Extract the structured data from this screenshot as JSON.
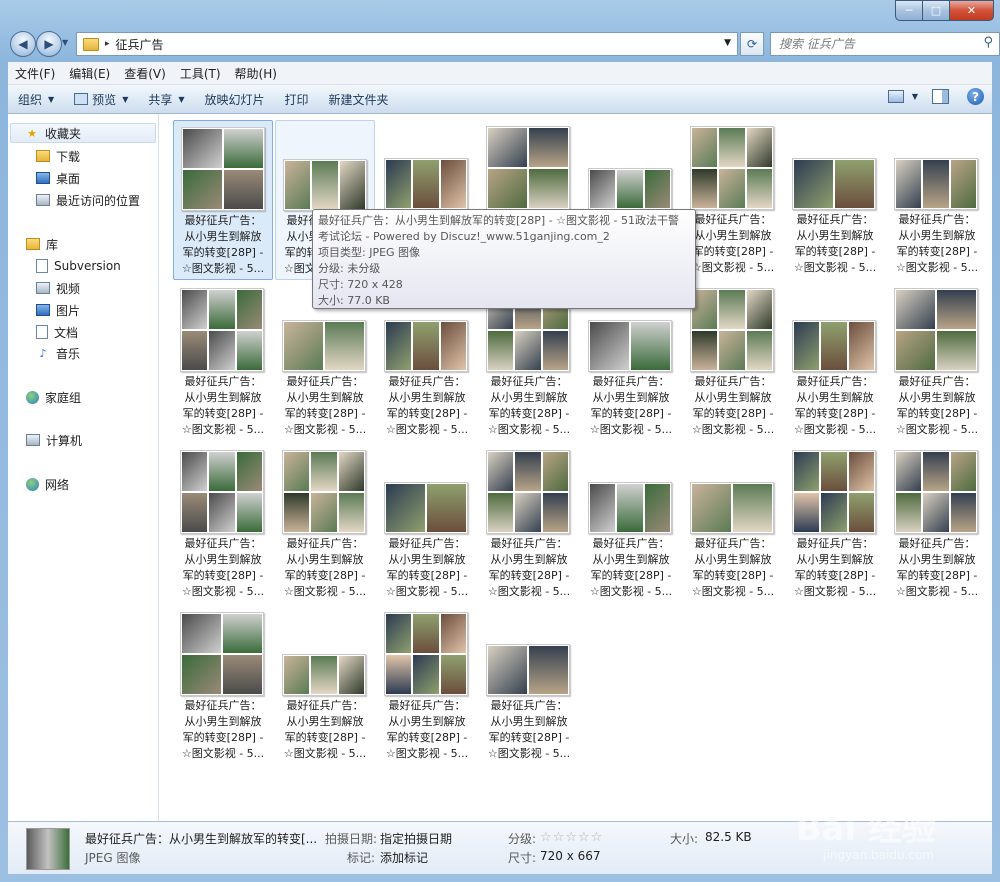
{
  "window": {
    "min_glyph": "─",
    "max_glyph": "□",
    "close_glyph": "✕"
  },
  "address": {
    "folder": "征兵广告",
    "separator": "▸"
  },
  "search": {
    "placeholder": "搜索 征兵广告"
  },
  "menu": [
    "文件(F)",
    "编辑(E)",
    "查看(V)",
    "工具(T)",
    "帮助(H)"
  ],
  "toolbar": {
    "organize": "组织",
    "preview": "预览",
    "share": "共享",
    "slideshow": "放映幻灯片",
    "print": "打印",
    "new_folder": "新建文件夹",
    "help": "?"
  },
  "sidebar": {
    "favorites": "收藏夹",
    "downloads": "下载",
    "desktop": "桌面",
    "recent": "最近访问的位置",
    "libraries": "库",
    "subversion": "Subversion",
    "videos": "视频",
    "pictures": "图片",
    "documents": "文档",
    "music": "音乐",
    "homegroup": "家庭组",
    "computer": "计算机",
    "network": "网络"
  },
  "file_caption": "最好征兵广告：\n从小男生到解放\n军的转变[28P] -\n☆图文影视 - 5...",
  "file_count": 28,
  "tooltip": {
    "name_line1": "最好征兵广告：从小男生到解放军的转变[28P] - ☆图文影视 - 51政法干警",
    "name_line2": "考试论坛 - Powered by Discuz!_www.51ganjing.com_2",
    "type": "项目类型: JPEG 图像",
    "rating": "分级: 未分级",
    "dimensions": "尺寸: 720 x 428",
    "size": "大小: 77.0 KB"
  },
  "details": {
    "name": "最好征兵广告：从小男生到解放军的转变[...",
    "type": "JPEG 图像",
    "date_label": "拍摄日期:",
    "date_value": "指定拍摄日期",
    "tags_label": "标记:",
    "tags_value": "添加标记",
    "rating_label": "分级:",
    "rating_stars": 0,
    "dims_label": "尺寸:",
    "dims_value": "720 x 667",
    "size_label": "大小:",
    "size_value": "82.5 KB"
  },
  "watermark": {
    "main": "Bai 经验",
    "sub": "jingyan.baidu.com"
  }
}
